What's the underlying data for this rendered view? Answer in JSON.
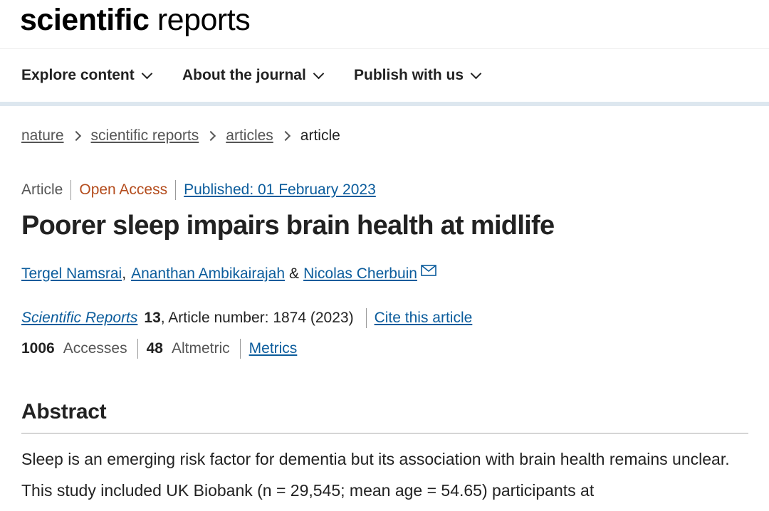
{
  "logo": {
    "bold": "scientific",
    "light": "reports"
  },
  "nav": [
    {
      "label": "Explore content"
    },
    {
      "label": "About the journal"
    },
    {
      "label": "Publish with us"
    }
  ],
  "breadcrumb": {
    "items": [
      "nature",
      "scientific reports",
      "articles"
    ],
    "current": "article"
  },
  "article": {
    "type": "Article",
    "access": "Open Access",
    "published": "Published: 01 February 2023",
    "title": "Poorer sleep impairs brain health at midlife",
    "authors": {
      "a1": "Tergel Namsrai",
      "sep1": ",",
      "a2": "Ananthan Ambikairajah",
      "amp": "&",
      "a3": "Nicolas Cherbuin"
    },
    "citation": {
      "journal": "Scientific Reports",
      "volume": "13",
      "details": ", Article number: 1874 (2023)",
      "cite_link": "Cite this article"
    },
    "metrics": {
      "accesses_count": "1006",
      "accesses_label": "Accesses",
      "altmetric_count": "48",
      "altmetric_label": "Altmetric",
      "metrics_link": "Metrics"
    }
  },
  "abstract": {
    "heading": "Abstract",
    "text": "Sleep is an emerging risk factor for dementia but its association with brain health remains unclear. This study included UK Biobank (n = 29,545; mean age = 54.65) participants at"
  },
  "colors": {
    "link": "#0b5c9c",
    "open_access": "#b44d1e",
    "nav_rule": "#dde7ef"
  },
  "icons": {
    "nav_chevron": "chevron-down-icon",
    "breadcrumb_sep": "chevron-right-icon",
    "author_contact": "mail-icon"
  }
}
